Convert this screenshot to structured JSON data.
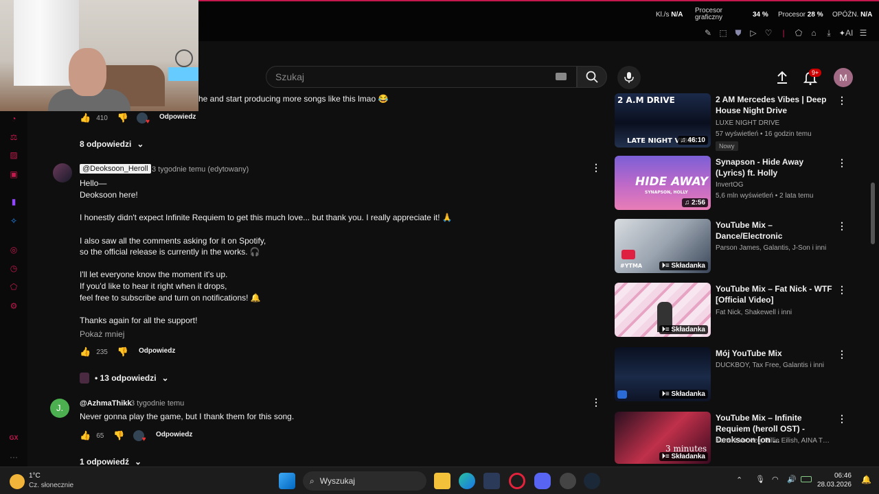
{
  "top_stats": {
    "kls_label": "Kl./s",
    "kls_value": "N/A",
    "gpu_label": "Procesor graficzny",
    "gpu_value": "34 %",
    "cpu_label": "Procesor",
    "cpu_value": "28 %",
    "delay_label": "OPÓŹN.",
    "delay_value": "N/A",
    "ai_label": "AI"
  },
  "header": {
    "search_placeholder": "Szukaj",
    "notification_count": "9+",
    "avatar_letter": "M"
  },
  "comments": {
    "first": {
      "text_fragment": "he and start producing more songs like this lmao 😂",
      "likes": "410",
      "reply_label": "Odpowiedz",
      "replies_toggle": "8 odpowiedzi"
    },
    "second": {
      "author": "@Deoksoon_Heroll",
      "time": "3 tygodnie temu (edytowany)",
      "lines": [
        "Hello—",
        "Deoksoon here!",
        "I honestly didn't expect Infinite Requiem to get this much love... but thank you. I really appreciate it! 🙏",
        "I also saw all the comments asking for it on Spotify,",
        "so the official release is currently in the works. 🎧",
        "I'll let everyone know the moment it's up.",
        "If you'd like to hear it right when it drops,",
        "feel free to subscribe and turn on notifications! 🔔",
        "Thanks again for all the support!"
      ],
      "show_less": "Pokaż mniej",
      "likes": "235",
      "reply_label": "Odpowiedz",
      "replies_toggle": "• 13 odpowiedzi"
    },
    "third": {
      "avatar_letter": "J.",
      "author": "@AzhmaThikk",
      "time": "3 tygodnie temu",
      "text": "Never gonna play the game, but I thank them for this song.",
      "likes": "65",
      "reply_label": "Odpowiedz",
      "replies_toggle": "1 odpowiedź"
    }
  },
  "recommendations": [
    {
      "title": "2 AM Mercedes Vibes | Deep House Night Drive",
      "channel": "LUXE NIGHT DRIVE",
      "meta": "57 wyświetleń • 16 godzin temu",
      "tag": "Nowy",
      "badge": "46:10",
      "thumb_text_top": "2 A.M DRIVE",
      "thumb_text_bottom": "LATE NIGHT VIBES"
    },
    {
      "title": "Synapson - Hide Away (Lyrics) ft. Holly",
      "channel": "InvertOG",
      "meta": "5,6 mln wyświetleń • 2 lata temu",
      "badge": "2:56",
      "thumb_text_top": "HIDE AWAY",
      "thumb_text_bottom": "SYNAPSON, HOLLY"
    },
    {
      "title": "YouTube Mix – Dance/Electronic",
      "channel": "Parson James, Galantis, J-Son i inni",
      "badge": "Składanka",
      "thumb_text_bottom": "#YTMA"
    },
    {
      "title": "YouTube Mix – Fat Nick - WTF [Official Video]",
      "channel": "Fat Nick, Shakewell i inni",
      "badge": "Składanka"
    },
    {
      "title": "Mój YouTube Mix",
      "channel": "DUCKBOY, Tax Free, Galantis i inni",
      "badge": "Składanka"
    },
    {
      "title": "YouTube Mix – Infinite Requiem (heroll OST) - Deoksoon [on ...",
      "channel": "Kenshi Yonezu, Billie Eilish, AINA THE EN...",
      "badge": "Składanka",
      "thumb_text_top": "3 minutes"
    }
  ],
  "taskbar": {
    "temperature": "1°C",
    "weather_desc": "Cz. słonecznie",
    "search_label": "Wyszukaj",
    "time": "06:46",
    "date": "28.03.2026"
  }
}
